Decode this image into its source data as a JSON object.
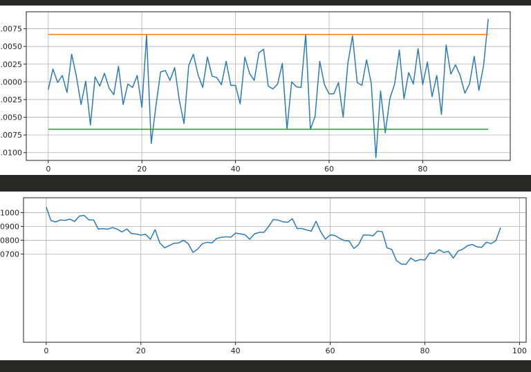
{
  "colors": {
    "series": "#2a7ab8",
    "upper": "#ff7f0e",
    "lower": "#2ca02c",
    "background": "#282824"
  },
  "chart_data": [
    {
      "type": "line",
      "title": "",
      "xlabel": "",
      "ylabel": "",
      "grid": true,
      "xlim": [
        -4.7,
        98.7
      ],
      "ylim": [
        -0.0111,
        0.0099
      ],
      "x_ticks": [
        0,
        20,
        40,
        60,
        80
      ],
      "x_tick_labels": [
        "0",
        "20",
        "40",
        "60",
        "80"
      ],
      "y_ticks": [
        0.0075,
        0.005,
        0.0025,
        0.0,
        -0.0025,
        -0.005,
        -0.0075,
        -0.01
      ],
      "y_tick_labels": [
        ".0075",
        ".0050",
        ".0025",
        ".0000",
        ".0025",
        ".0050",
        ".0075",
        ".0100"
      ],
      "series": [
        {
          "color": "#2a7ab8",
          "values": [
            -0.0011,
            0.0018,
            -0.0001,
            0.0009,
            -0.0015,
            0.0039,
            0.0008,
            -0.0032,
            0.0001,
            -0.0061,
            0.0007,
            -0.0006,
            0.0012,
            -0.0009,
            -0.0018,
            0.0022,
            -0.0032,
            -0.0003,
            -0.0008,
            0.0009,
            -0.0036,
            0.0066,
            -0.0087,
            -0.0034,
            0.0014,
            0.0016,
            0.0002,
            0.002,
            -0.0026,
            -0.0059,
            0.0023,
            0.0039,
            0.001,
            -0.0008,
            0.0035,
            0.0008,
            0.0006,
            -0.0004,
            0.0029,
            -0.0005,
            -0.0005,
            -0.0031,
            0.0035,
            0.0012,
            0.0002,
            0.0041,
            0.0046,
            -0.0006,
            -0.001,
            -0.0003,
            0.0026,
            -0.0067,
            0.0,
            -0.0007,
            -0.0008,
            0.0067,
            -0.0067,
            -0.0049,
            0.0029,
            -0.0004,
            -0.0017,
            -0.0017,
            -0.0001,
            -0.005,
            0.0026,
            0.0065,
            -0.0001,
            -0.0005,
            0.0031,
            -0.0002,
            -0.0107,
            -0.0013,
            -0.0072,
            -0.0023,
            -0.0003,
            0.0045,
            -0.0024,
            0.0013,
            -0.0003,
            0.0047,
            -0.0004,
            0.0028,
            -0.0021,
            0.0009,
            -0.0046,
            0.0052,
            0.0011,
            0.0024,
            0.0009,
            -0.0016,
            -0.0003,
            0.0036,
            -0.0012,
            0.0023,
            0.0089
          ]
        },
        {
          "color": "#ff7f0e",
          "x": [
            0,
            94
          ],
          "values": [
            0.0067,
            0.0067
          ]
        },
        {
          "color": "#2ca02c",
          "x": [
            0,
            94
          ],
          "values": [
            -0.0067,
            -0.0067
          ]
        }
      ]
    },
    {
      "type": "line",
      "title": "",
      "xlabel": "",
      "ylabel": "",
      "grid": true,
      "xlim": [
        -4.8,
        101.4
      ],
      "ylim": [
        0.906,
        1.0108
      ],
      "x_ticks": [
        0,
        20,
        40,
        60,
        80,
        100
      ],
      "x_tick_labels": [
        "0",
        "20",
        "40",
        "60",
        "80",
        "100"
      ],
      "y_ticks": [
        1.0,
        0.99,
        0.98,
        0.97
      ],
      "y_tick_labels": [
        "1000",
        "0900",
        "0800",
        "0700"
      ],
      "series": [
        {
          "color": "#2a7ab8",
          "values": [
            1.0041,
            0.9943,
            0.9932,
            0.9947,
            0.9944,
            0.9953,
            0.9936,
            0.9975,
            0.998,
            0.9948,
            0.9947,
            0.9881,
            0.9884,
            0.988,
            0.9892,
            0.988,
            0.986,
            0.9882,
            0.9849,
            0.9845,
            0.9837,
            0.9843,
            0.9807,
            0.9876,
            0.978,
            0.9745,
            0.9761,
            0.9778,
            0.978,
            0.98,
            0.9775,
            0.9712,
            0.9736,
            0.9775,
            0.9785,
            0.978,
            0.9813,
            0.9821,
            0.9825,
            0.9822,
            0.9852,
            0.9846,
            0.984,
            0.9807,
            0.9846,
            0.9857,
            0.9857,
            0.99,
            0.9951,
            0.9946,
            0.9934,
            0.993,
            0.9956,
            0.9885,
            0.9885,
            0.9875,
            0.9866,
            0.9938,
            0.986,
            0.9808,
            0.9839,
            0.9834,
            0.9813,
            0.9798,
            0.9794,
            0.974,
            0.9768,
            0.9838,
            0.9838,
            0.9832,
            0.9866,
            0.9862,
            0.9745,
            0.9733,
            0.9652,
            0.9628,
            0.9625,
            0.9671,
            0.9648,
            0.966,
            0.9656,
            0.9708,
            0.9703,
            0.9731,
            0.9712,
            0.9719,
            0.967,
            0.9721,
            0.9735,
            0.976,
            0.977,
            0.9752,
            0.9748,
            0.9786,
            0.9775,
            0.9797,
            0.9892
          ]
        }
      ]
    }
  ]
}
